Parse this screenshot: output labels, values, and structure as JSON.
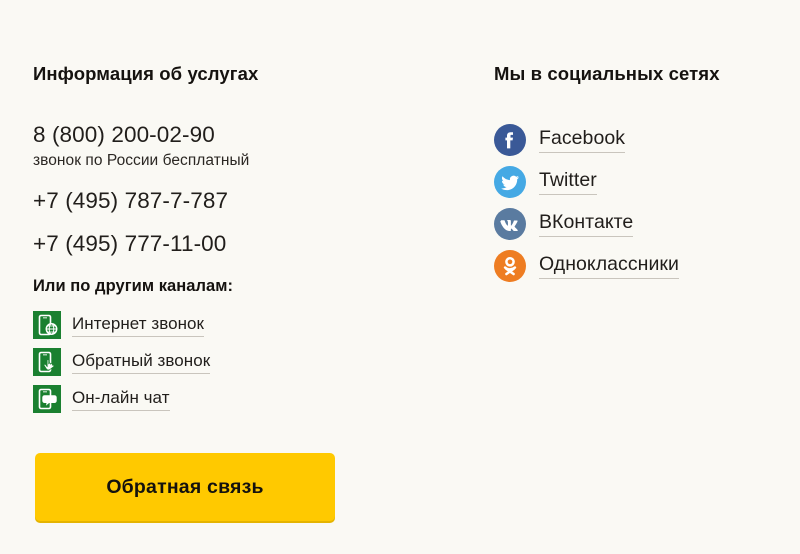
{
  "theme": {
    "background": "#faf9f4",
    "text": "#211e1b",
    "heading": "#15120f",
    "link_underline": "#c9c5bd",
    "green_icon": "#1a8030",
    "button_bg": "#ffc900",
    "button_shadow": "#e5b400",
    "button_text": "#14120e"
  },
  "services": {
    "heading": "Информация об услугах",
    "phones": [
      {
        "number": "8 (800) 200-02-90",
        "note": "звонок по России бесплатный"
      },
      {
        "number": "+7 (495) 787-7-787",
        "note": ""
      },
      {
        "number": "+7 (495) 777-11-00",
        "note": ""
      }
    ],
    "channels_title": "Или по другим каналам:",
    "channels": [
      {
        "label": "Интернет звонок",
        "icon": "phone-internet-call-icon"
      },
      {
        "label": "Обратный звонок",
        "icon": "phone-callback-icon"
      },
      {
        "label": "Он-лайн чат",
        "icon": "phone-online-chat-icon"
      }
    ],
    "feedback_button": "Обратная связь"
  },
  "social": {
    "heading": "Мы в социальных сетях",
    "links": [
      {
        "label": "Facebook",
        "icon": "facebook-icon",
        "color": "#3a5997"
      },
      {
        "label": "Twitter",
        "icon": "twitter-icon",
        "color": "#45a9e4"
      },
      {
        "label": "ВКонтакте",
        "icon": "vk-icon",
        "color": "#5a7ba0"
      },
      {
        "label": "Одноклассники",
        "icon": "odnoklassniki-icon",
        "color": "#ee7d22"
      }
    ]
  }
}
